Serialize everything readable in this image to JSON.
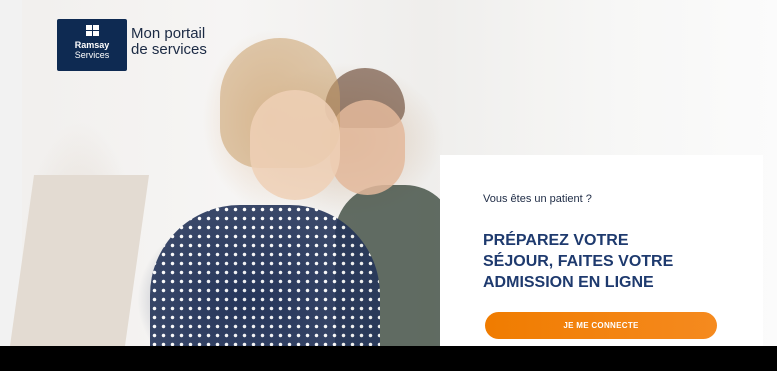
{
  "header": {
    "logo": {
      "name": "Ramsay",
      "sub": "Services",
      "icon": "ramsay-grid-icon",
      "color": "#0e2a52"
    },
    "portal_title_line1": "Mon portail",
    "portal_title_line2": "de services"
  },
  "card": {
    "question": "Vous êtes un patient ?",
    "heading_line1": "PRÉPAREZ VOTRE",
    "heading_line2": "SÉJOUR, FAITES VOTRE",
    "heading_line3": "ADMISSION EN LIGNE",
    "cta_label": "JE ME CONNECTE",
    "heading_color": "#1e3a6e",
    "cta_color": "#f07c00"
  }
}
